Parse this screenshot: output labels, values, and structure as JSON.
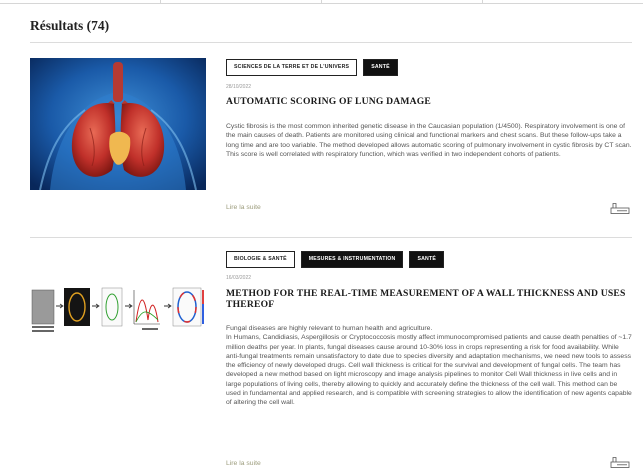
{
  "results": {
    "heading": "Résultats (74)"
  },
  "articles": [
    {
      "tags": [
        "Sciences de la Terre et de l'Univers",
        "Santé"
      ],
      "date": "28/10/2022",
      "title": "AUTOMATIC SCORING OF LUNG DAMAGE",
      "paragraphs": [
        "Cystic fibrosis is the most common inherited genetic disease in the Caucasian population (1/4500). Respiratory involvement is one of the main causes of death. Patients are monitored using clinical and functional markers and chest scans. But these follow-ups take a long time and are too variable. The method developed allows automatic scoring of pulmonary involvement in cystic fibrosis by CT scan. This score is well correlated with respiratory function, which was verified in two independent cohorts of patients."
      ],
      "read_more": "Lire la suite",
      "icon": "bookmark-icon"
    },
    {
      "tags": [
        "Biologie & Santé",
        "Mesures & Instrumentation",
        "Santé"
      ],
      "date": "16/03/2022",
      "title": "METHOD FOR THE REAL-TIME MEASUREMENT OF A WALL THICKNESS AND USES THEREOF",
      "paragraphs": [
        "Fungal diseases are highly relevant to human health and agriculture.",
        "In Humans, Candidiasis, Aspergillosis or Cryptococcosis mostly affect immunocompromised patients and cause death penalties of ~1.7 million deaths per year. In plants, fungal diseases cause around 10-30% loss in crops representing a risk for food availability. While anti-fungal treatments remain unsatisfactory to date due to species diversity and adaptation mechanisms, we need new tools to assess the efficiency of newly developed drugs. Cell wall thickness is critical for the survival and development of fungal cells. The team has developed a new method based on light microscopy and image analysis pipelines to monitor Cell Wall thickness in live cells and in large populations of living cells, thereby allowing to quickly and accurately define the thickness of the cell wall. This method can be used in fundamental and applied research, and is compatible with screening strategies to allow the identification of new agents capable of altering the cell wall."
      ],
      "read_more": "Lire la suite",
      "icon": "bookmark-icon"
    }
  ],
  "colors": {
    "tag_solid_bg": "#111111",
    "read_more": "#9c9c7c",
    "lung_bg": "#0d3a7a",
    "lung_red": "#c0302a"
  }
}
